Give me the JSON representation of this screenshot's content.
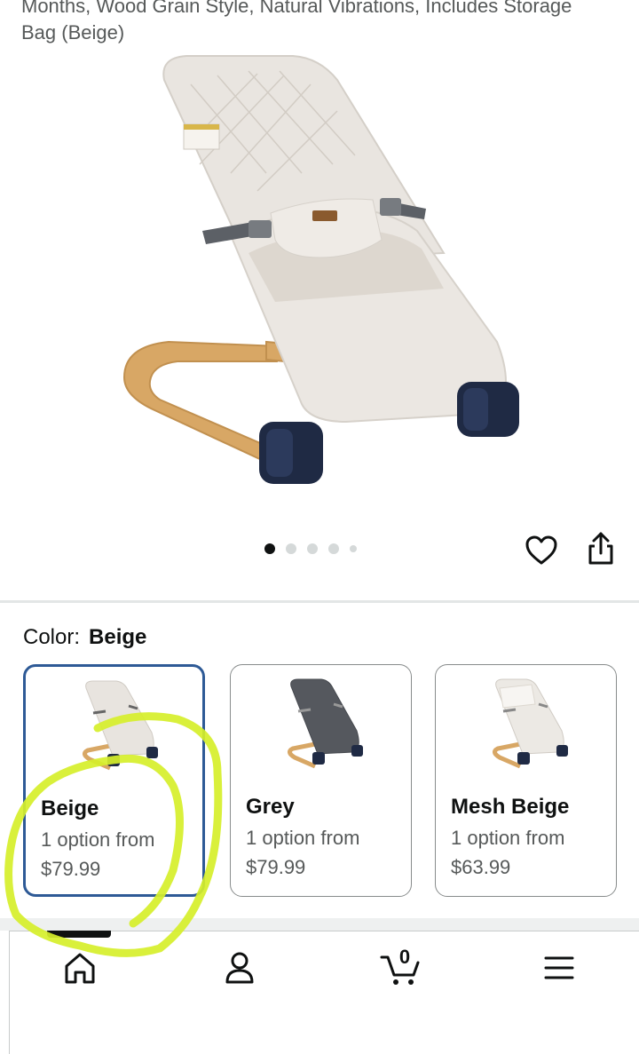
{
  "product": {
    "title": "Months, Wood Grain Style, Natural Vibrations, Includes Storage Bag (Beige)"
  },
  "gallery": {
    "image_count": 5,
    "active_index": 0
  },
  "actions": {
    "wishlist_icon": "heart-icon",
    "share_icon": "share-icon"
  },
  "color_selector": {
    "label": "Color:",
    "selected_value": "Beige",
    "options": [
      {
        "name": "Beige",
        "availability": "1 option from",
        "price": "$79.99",
        "selected": true,
        "fabric_color": "#e8e4df"
      },
      {
        "name": "Grey",
        "availability": "1 option from",
        "price": "$79.99",
        "selected": false,
        "fabric_color": "#55585e"
      },
      {
        "name": "Mesh Beige",
        "availability": "1 option from",
        "price": "$63.99",
        "selected": false,
        "fabric_color": "#ece9e4"
      }
    ]
  },
  "bottom_nav": {
    "items": [
      "home-icon",
      "account-icon",
      "cart-icon",
      "menu-icon"
    ],
    "cart_count": "0",
    "active": "home-icon"
  },
  "colors": {
    "selected_border": "#2e5a96",
    "highlight_annotation": "#d6ef2a",
    "wood": "#d8a765",
    "wheel": "#1f2a44"
  }
}
